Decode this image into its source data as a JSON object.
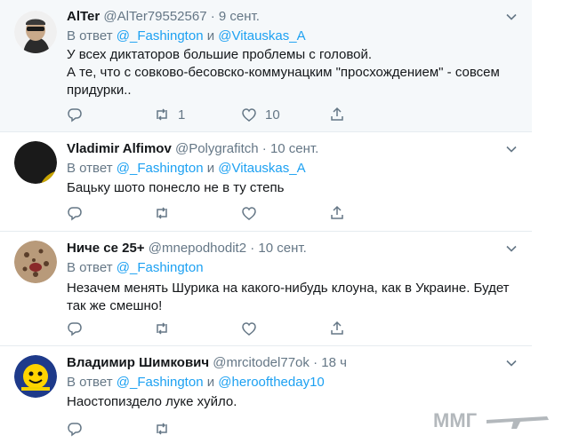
{
  "tweets": [
    {
      "name": "AlTer",
      "handle": "@AlTer79552567",
      "dot": "·",
      "time": "9 сент.",
      "reply_prefix": "В ответ",
      "mention1": "@_Fashington",
      "conj": "и",
      "mention2": "@Vitauskas_A",
      "text_lines": [
        "У всех диктаторов большие проблемы с головой.",
        "А те, что с совково-бесовско-коммунацким \"просхождением\" - совсем придурки.."
      ],
      "retweets": "1",
      "likes": "10"
    },
    {
      "name": "Vladimir Alfimov",
      "handle": "@Polygrafitch",
      "dot": "·",
      "time": "10 сент.",
      "reply_prefix": "В ответ",
      "mention1": "@_Fashington",
      "conj": "и",
      "mention2": "@Vitauskas_A",
      "text_lines": [
        "Бацьку шото понесло не в ту степь"
      ],
      "retweets": "",
      "likes": ""
    },
    {
      "name": "Ниче се 25+",
      "handle": "@mnepodhodit2",
      "dot": "·",
      "time": "10 сент.",
      "reply_prefix": "В ответ",
      "mention1": "@_Fashington",
      "conj": "",
      "mention2": "",
      "text_lines": [
        "Незачем менять Шурика на какого-нибудь клоуна, как в Украине. Будет",
        "так же смешно!"
      ],
      "retweets": "",
      "likes": ""
    },
    {
      "name": "Владимир Шимкович",
      "handle": "@mrcitodel77ok",
      "dot": "·",
      "time": "18 ч",
      "reply_prefix": "В ответ",
      "mention1": "@_Fashington",
      "conj": "и",
      "mention2": "@herooftheday10",
      "text_lines": [
        "Наостопиздело луке хуйло."
      ],
      "retweets": "",
      "likes": ""
    }
  ],
  "watermark": {
    "text": "ММГ"
  },
  "icons": {
    "reply": "reply-icon",
    "retweet": "retweet-icon",
    "like": "heart-icon",
    "share": "share-icon",
    "more": "chevron-down-icon"
  },
  "colors": {
    "link": "#1da1f2",
    "secondary": "#657786",
    "divider": "#e6ecf0",
    "highlight": "#f5f8fa"
  }
}
